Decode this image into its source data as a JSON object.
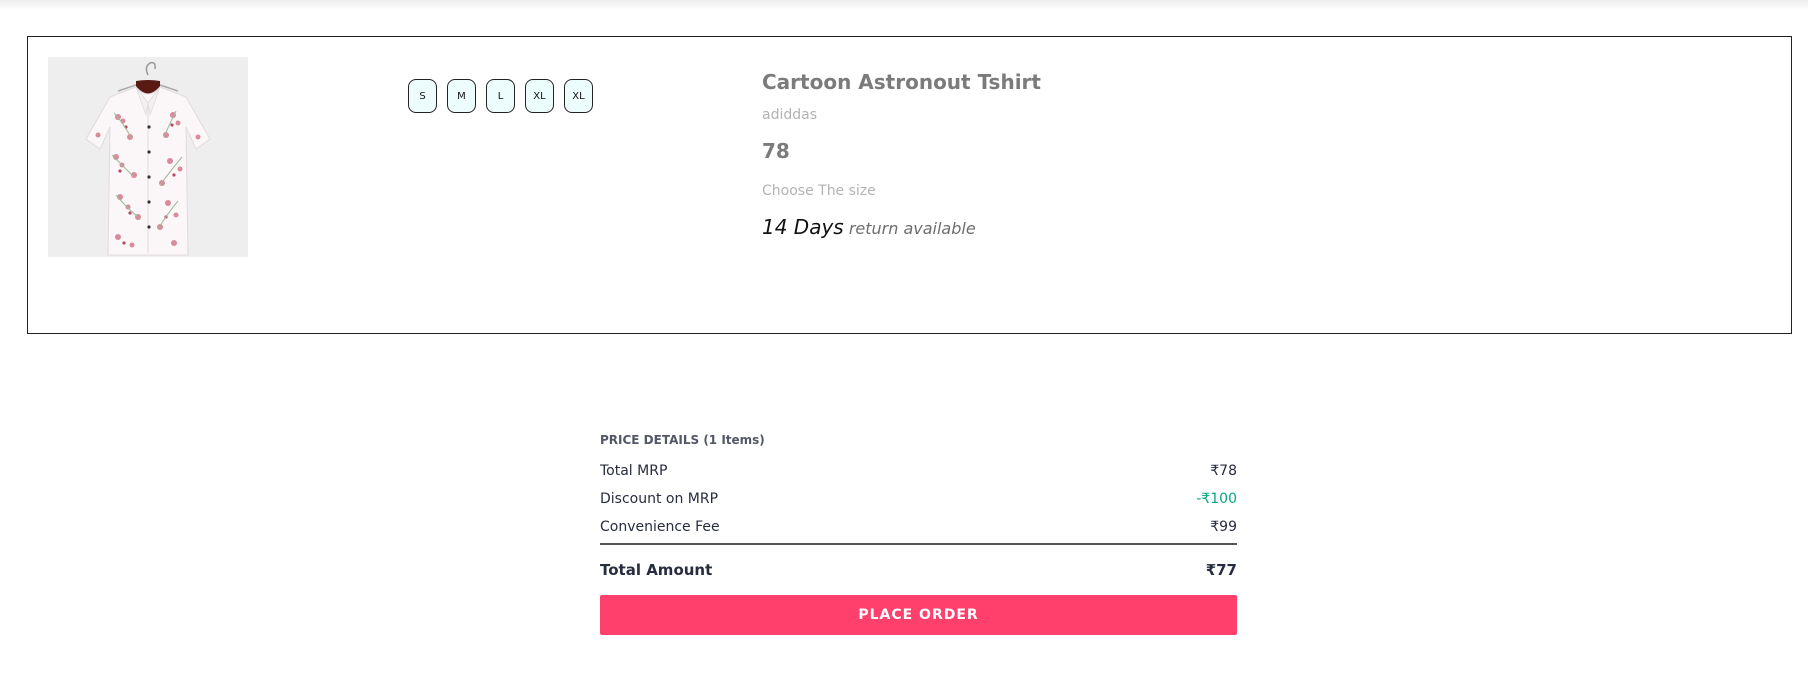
{
  "product": {
    "title": "Cartoon Astronout Tshirt",
    "brand": "adiddas",
    "price": "78",
    "size_prompt": "Choose The size",
    "return_days": "14 Days",
    "return_text": "return available",
    "sizes": [
      "S",
      "M",
      "L",
      "XL",
      "XL"
    ]
  },
  "price_details": {
    "header": "PRICE DETAILS (1 Items)",
    "total_mrp_label": "Total MRP",
    "total_mrp_value": "₹78",
    "discount_label": "Discount on MRP",
    "discount_value": "-₹100",
    "fee_label": "Convenience Fee",
    "fee_value": "₹99",
    "total_label": "Total Amount",
    "total_value": "₹77"
  },
  "actions": {
    "place_order_label": "PLACE ORDER"
  },
  "colors": {
    "accent": "#ff3f6c",
    "discount": "#03a685",
    "size_chip_bg": "#edfcfc"
  }
}
